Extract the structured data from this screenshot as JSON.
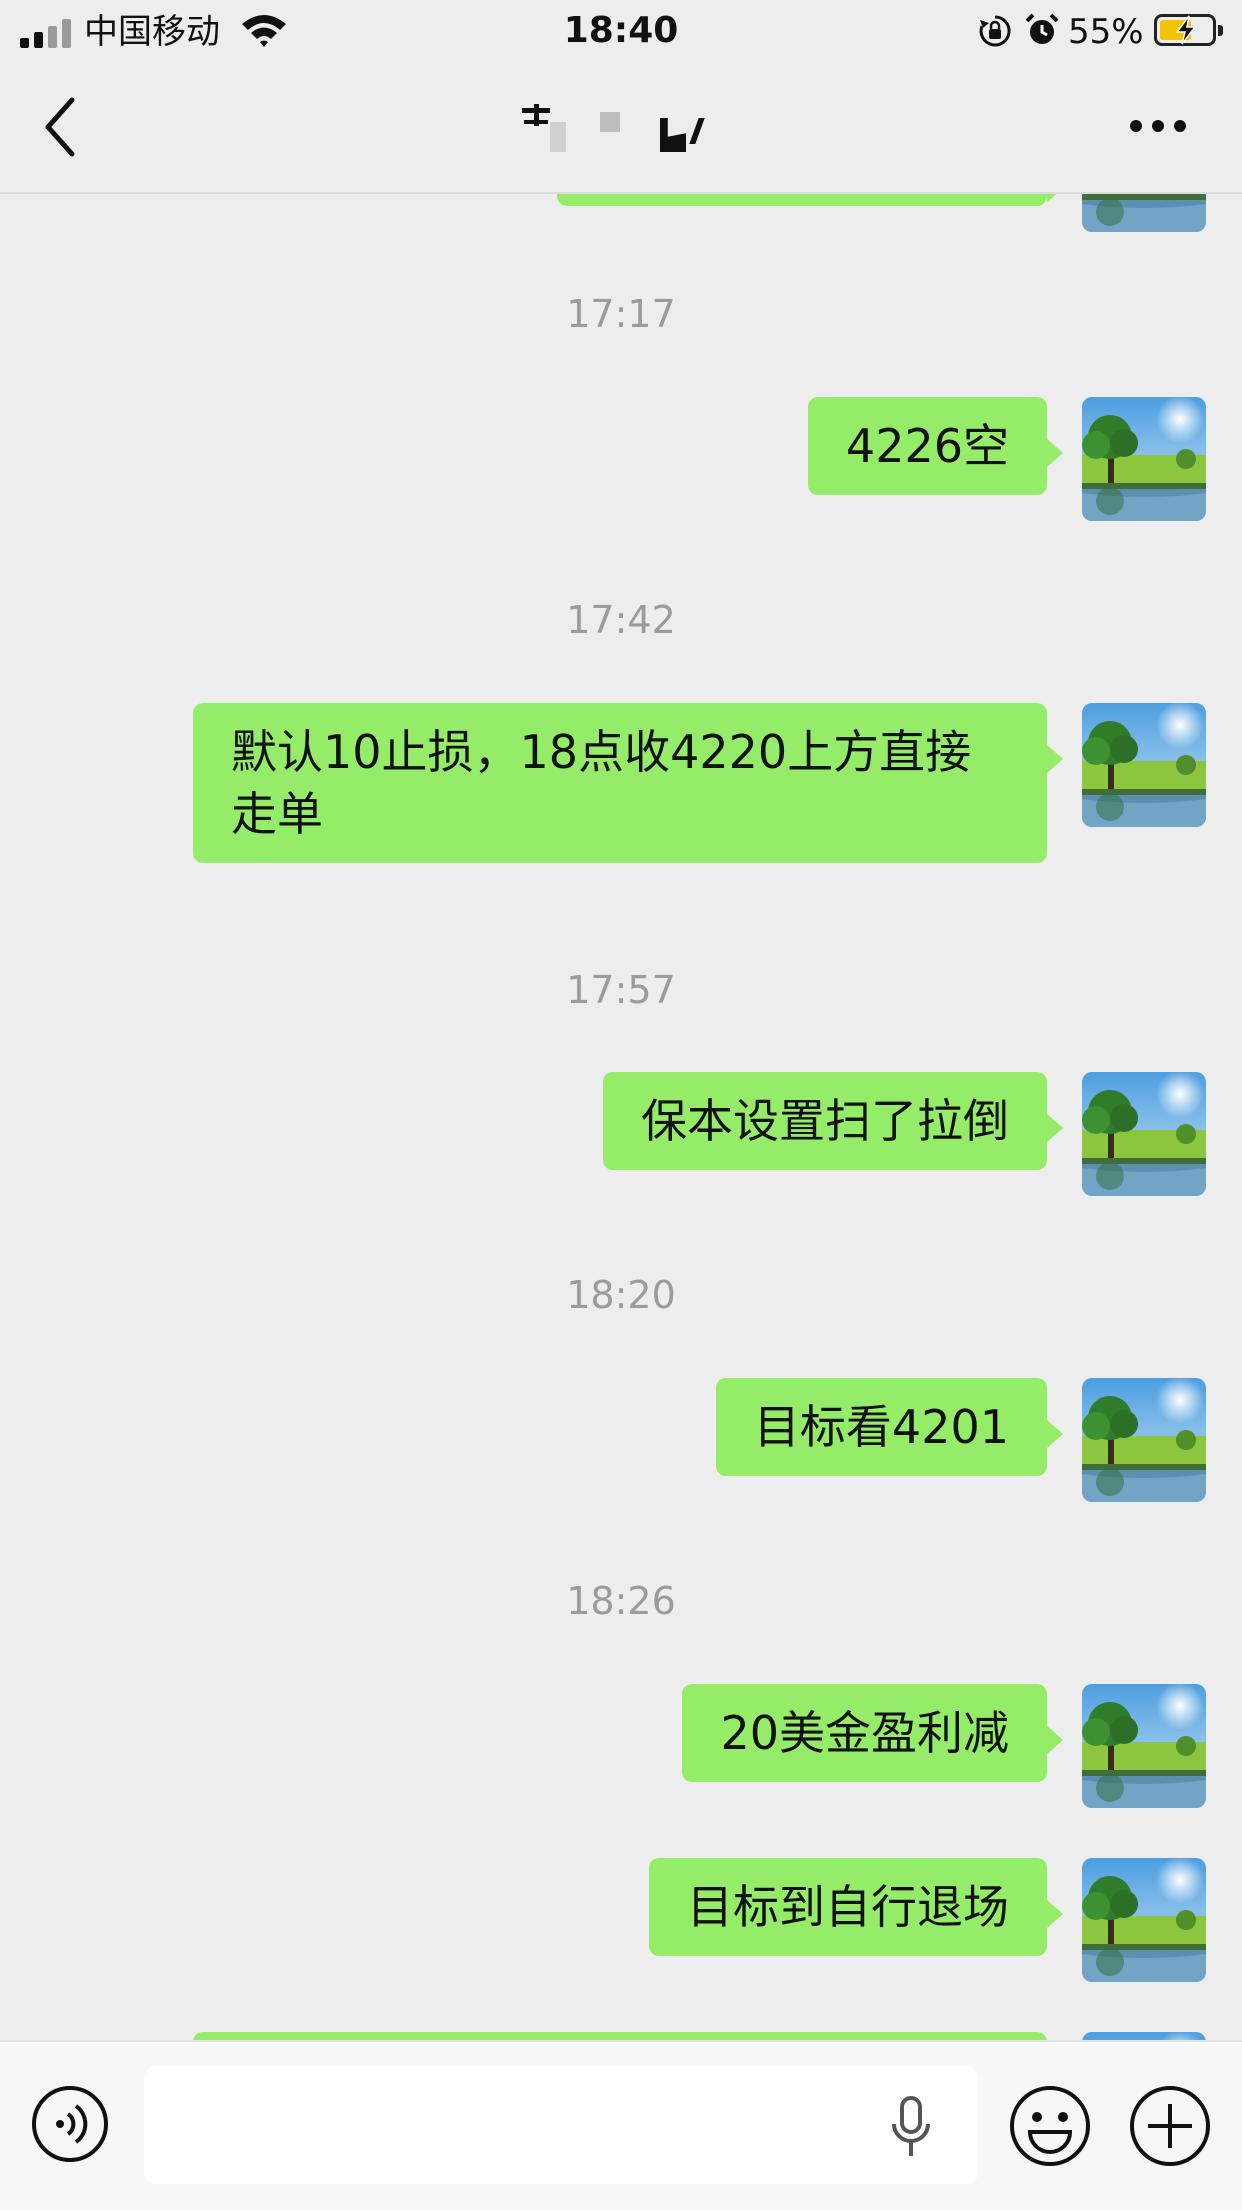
{
  "status_bar": {
    "carrier": "中国移动",
    "time": "18:40",
    "battery_percent": "55%",
    "battery_level": 0.55,
    "icons": [
      "signal-icon",
      "wifi-icon",
      "orientation-lock-icon",
      "alarm-icon",
      "battery-charging-icon"
    ]
  },
  "nav": {
    "title": "",
    "icons": [
      "back-chevron-icon",
      "more-icon"
    ]
  },
  "chat": {
    "timestamps": [
      "17:17",
      "17:42",
      "17:57",
      "18:20",
      "18:26"
    ],
    "messages": [
      {
        "text": "4226空",
        "sender": "self"
      },
      {
        "text": "默认10止损，18点收4220上方直接走单",
        "sender": "self"
      },
      {
        "text": "保本设置扫了拉倒",
        "sender": "self"
      },
      {
        "text": "目标看4201",
        "sender": "self"
      },
      {
        "text": "20美金盈利减",
        "sender": "self"
      },
      {
        "text": "目标到自行退场",
        "sender": "self"
      }
    ]
  },
  "input_bar": {
    "value": "",
    "icons": [
      "voice-icon",
      "mic-icon",
      "emoji-icon",
      "plus-icon"
    ]
  },
  "colors": {
    "background": "#ededed",
    "bubble": "#95ec69",
    "timestamp": "#9b9b9b",
    "input_bar": "#f7f7f7"
  }
}
